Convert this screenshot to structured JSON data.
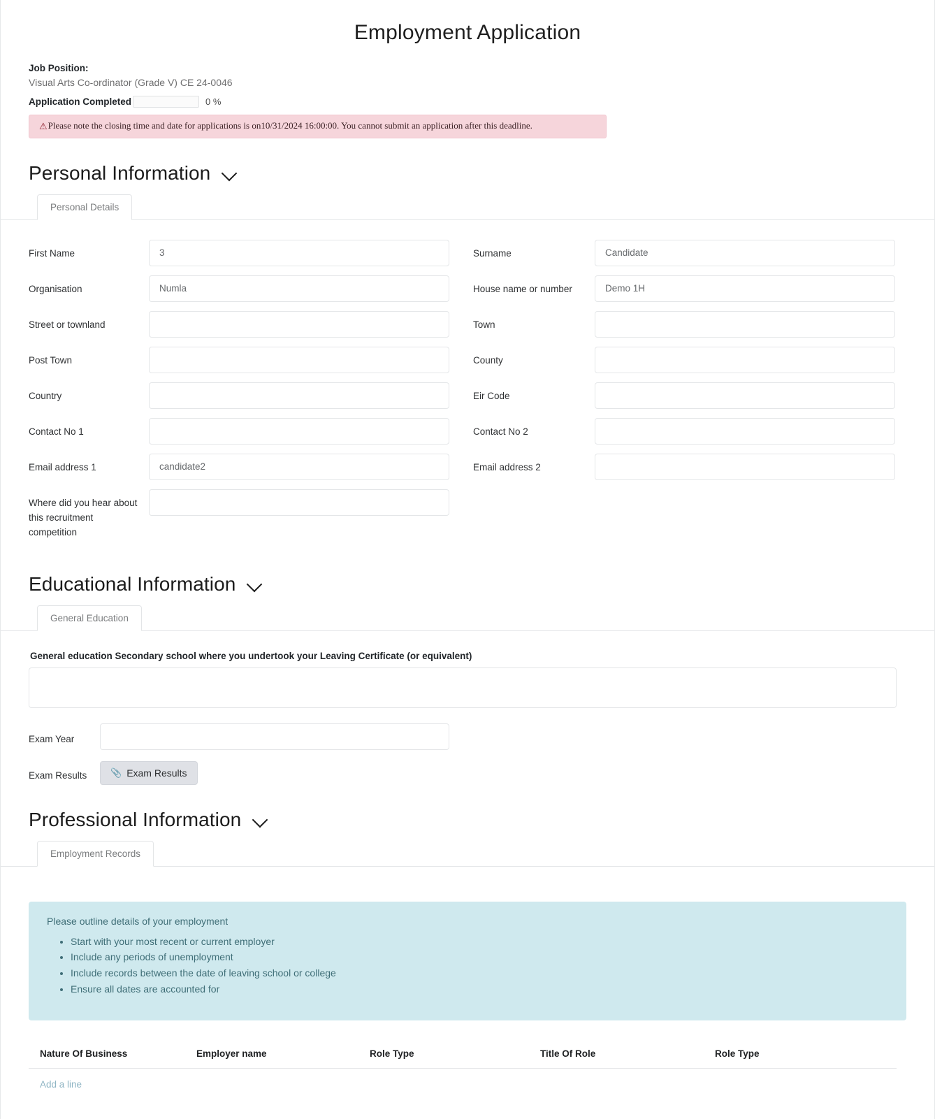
{
  "document": {
    "title": "Employment Application"
  },
  "header": {
    "job_position_label": "Job Position:",
    "job_position_value": "Visual Arts Co-ordinator (Grade V) CE 24-0046",
    "progress_label": "Application Completed",
    "progress_percent_text": "0 %",
    "progress_percent": 0,
    "alert_icon": "warning-triangle-icon",
    "alert_text": "Please note the closing time and date for applications is on10/31/2024 16:00:00. You cannot submit an application after this deadline."
  },
  "sections": {
    "personal": {
      "title": "Personal Information",
      "chevron_icon": "chevron-down-icon",
      "tab": "Personal Details",
      "left_fields": [
        {
          "label": "First Name",
          "value": "3",
          "placeholder": ""
        },
        {
          "label": "Organisation",
          "value": "Numla",
          "placeholder": ""
        },
        {
          "label": "Street or townland",
          "value": "",
          "placeholder": ""
        },
        {
          "label": "Post Town",
          "value": "",
          "placeholder": ""
        },
        {
          "label": "Country",
          "value": "",
          "placeholder": ""
        },
        {
          "label": "Contact No 1",
          "value": "",
          "placeholder": ""
        },
        {
          "label": "Email address 1",
          "value": "candidate2",
          "placeholder": ""
        },
        {
          "label": "Where did you hear about this recruitment competition",
          "value": "",
          "placeholder": ""
        }
      ],
      "right_fields": [
        {
          "label": "Surname",
          "value": "Candidate",
          "placeholder": ""
        },
        {
          "label": "House name or number",
          "value": "Demo 1H",
          "placeholder": ""
        },
        {
          "label": "Town",
          "value": "",
          "placeholder": ""
        },
        {
          "label": "County",
          "value": "",
          "placeholder": ""
        },
        {
          "label": "Eir Code",
          "value": "",
          "placeholder": ""
        },
        {
          "label": "Contact No 2",
          "value": "",
          "placeholder": ""
        },
        {
          "label": "Email address 2",
          "value": "",
          "placeholder": ""
        }
      ]
    },
    "educational": {
      "title": "Educational Information",
      "chevron_icon": "chevron-down-icon",
      "tab": "General Education",
      "heading": "General education Secondary school where you undertook your Leaving Certificate (or equivalent)",
      "school_value": "",
      "exam_year_label": "Exam Year",
      "exam_year_value": "",
      "exam_results_label": "Exam Results",
      "exam_results_button": "Exam Results",
      "exam_results_button_icon": "paperclip-icon"
    },
    "professional": {
      "title": "Professional Information",
      "chevron_icon": "chevron-down-icon",
      "tab": "Employment Records",
      "info_lead": "Please outline details of your employment",
      "info_bullets": [
        "Start with your most recent or current employer",
        "Include any periods of unemployment",
        "Include records between the date of leaving school or college",
        "Ensure all dates are accounted for"
      ],
      "table_headers": [
        "Nature Of Business",
        "Employer name",
        "Role Type",
        "Title Of Role",
        "Role Type"
      ],
      "table_rows": [],
      "add_line_label": "Add a line"
    }
  },
  "colors": {
    "alert_bg": "#f6d5db",
    "alert_icon": "#8e2230",
    "info_panel_bg": "#cfe9ee",
    "info_panel_text": "#3f6e77",
    "link": "#8fb5c4",
    "attach_button_bg": "#dfe1e6"
  }
}
